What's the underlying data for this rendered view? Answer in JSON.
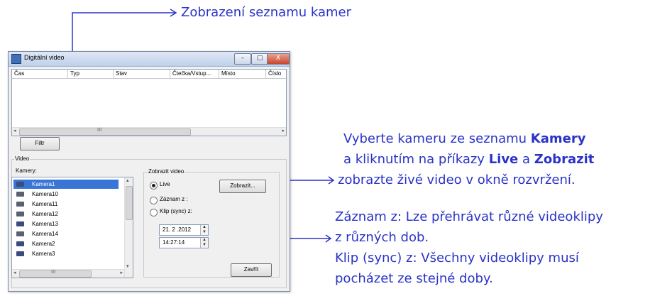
{
  "annotations": {
    "top": "Zobrazení seznamu kamer",
    "right1_line1_pre": "Vyberte kameru ze seznamu ",
    "right1_line1_bold": "Kamery",
    "right1_line2_pre": "a kliknutím na příkazy ",
    "right1_line2_bold1": "Live",
    "right1_line2_mid": " a ",
    "right1_line2_bold2": "Zobrazit",
    "right1_line3": "zobrazte živé video v okně rozvržení.",
    "right2_line1": "Záznam z: Lze přehrávat různé videoklipy",
    "right2_line2": "z různých dob.",
    "right2_line3": "Klip (sync) z: Všechny videoklipy musí",
    "right2_line4": "pocházet ze stejné doby."
  },
  "window": {
    "title": "Digitální video",
    "minimize": "–",
    "maximize": "□",
    "close": "X"
  },
  "events": {
    "columns": [
      "Čas",
      "Typ",
      "Stav",
      "Čtečka/Vstup...",
      "Místo",
      "Číslo"
    ],
    "scroll_grip": "III"
  },
  "filter_button": "Filtr",
  "video_group": {
    "label": "Video",
    "cameras_label": "Kamery:",
    "cameras": [
      {
        "name": "Kamera1",
        "icon": "dome-camera-icon",
        "selected": true
      },
      {
        "name": "Kamera10",
        "icon": "camera-icon",
        "selected": false
      },
      {
        "name": "Kamera11",
        "icon": "camera-icon",
        "selected": false
      },
      {
        "name": "Kamera12",
        "icon": "camera-icon",
        "selected": false
      },
      {
        "name": "Kamera13",
        "icon": "dome-camera-icon",
        "selected": false
      },
      {
        "name": "Kamera14",
        "icon": "camera-icon",
        "selected": false
      },
      {
        "name": "Kamera2",
        "icon": "dome-camera-icon",
        "selected": false
      },
      {
        "name": "Kamera3",
        "icon": "dome-camera-icon",
        "selected": false
      }
    ],
    "list_scroll_grip": "III"
  },
  "show_video": {
    "label": "Zobrazit video",
    "live": "Live",
    "show_button": "Zobrazit...",
    "record_from": "Záznam z :",
    "clip_sync_from": "Klip (sync) z:",
    "date": "21. 2 .2012",
    "time": "14:27:14",
    "close_button": "Zavřít"
  },
  "colors": {
    "annotation": "#2a33c8",
    "selection": "#3875d7"
  }
}
